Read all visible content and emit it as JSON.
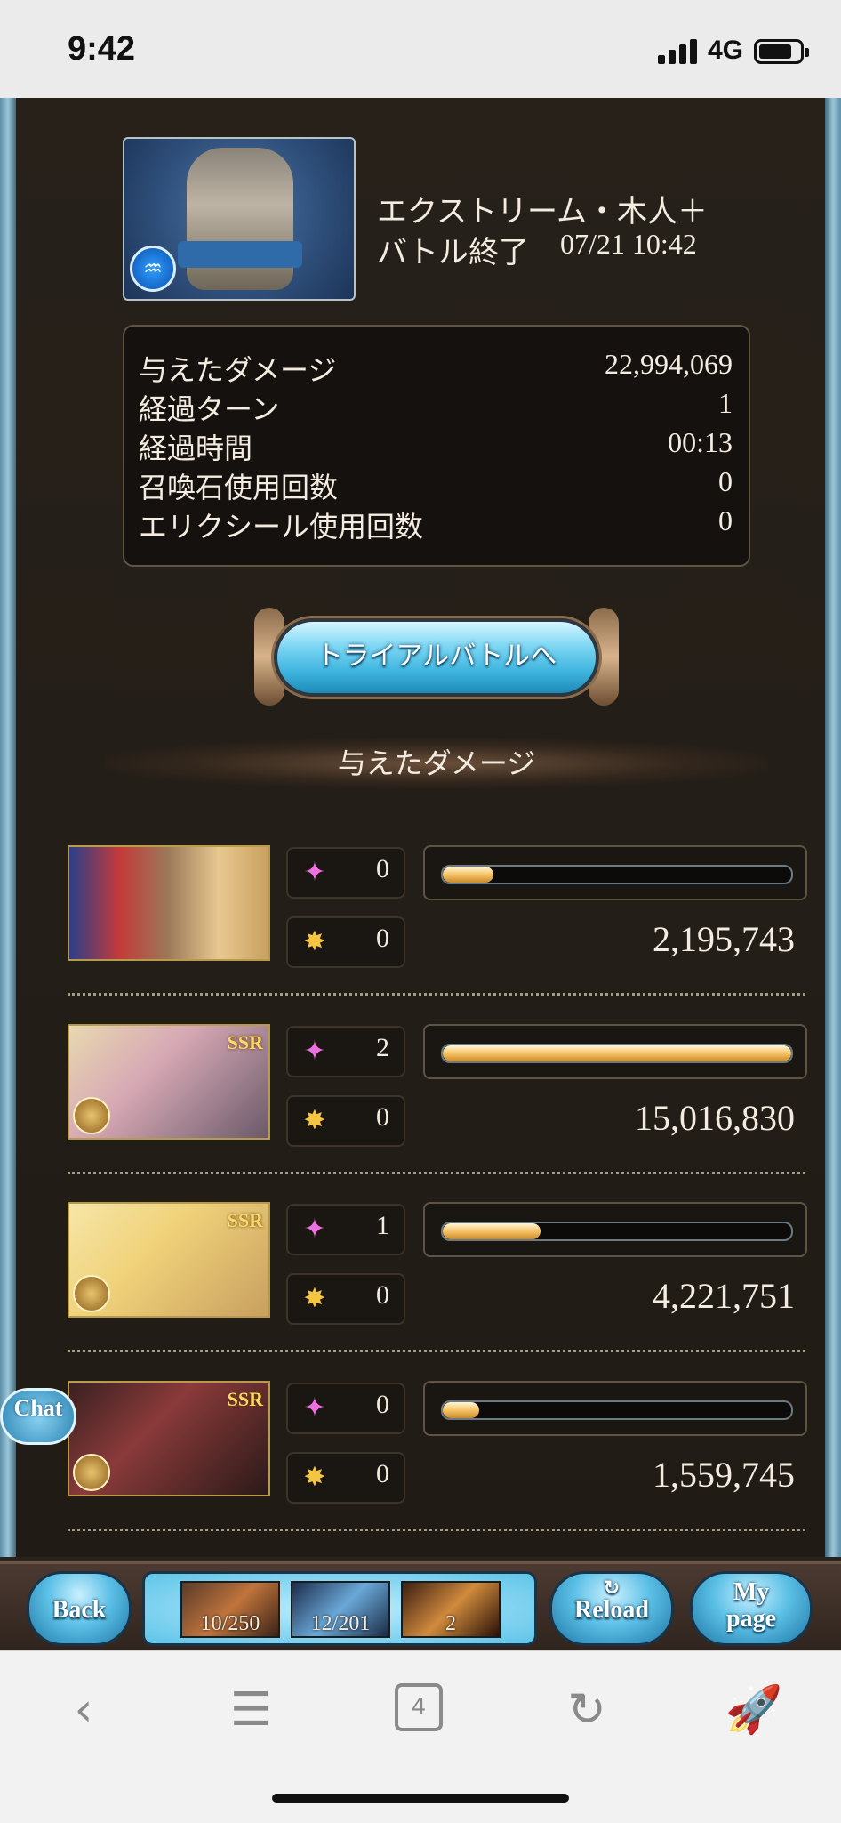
{
  "status_bar": {
    "time": "9:42",
    "network": "4G"
  },
  "battle": {
    "boss_name": "エクストリーム・木人＋",
    "status": "バトル終了",
    "datetime": "07/21 10:42",
    "element_icon": "water-icon"
  },
  "stats": [
    {
      "label": "与えたダメージ",
      "value": "22,994,069"
    },
    {
      "label": "経過ターン",
      "value": "1"
    },
    {
      "label": "経過時間",
      "value": "00:13"
    },
    {
      "label": "召喚石使用回数",
      "value": "0"
    },
    {
      "label": "エリクシール使用回数",
      "value": "0"
    }
  ],
  "trial_button": {
    "label": "トライアルバトルへ"
  },
  "section": {
    "title": "与えたダメージ"
  },
  "characters": [
    {
      "ssr": "",
      "ougi": "0",
      "chain": "0",
      "damage": "2,195,743",
      "ratio": 0.146
    },
    {
      "ssr": "SSR",
      "ougi": "2",
      "chain": "0",
      "damage": "15,016,830",
      "ratio": 1.0
    },
    {
      "ssr": "SSR",
      "ougi": "1",
      "chain": "0",
      "damage": "4,221,751",
      "ratio": 0.281
    },
    {
      "ssr": "SSR",
      "ougi": "0",
      "chain": "0",
      "damage": "1,559,745",
      "ratio": 0.104
    }
  ],
  "chat": {
    "label": "Chat"
  },
  "nav": {
    "back": "Back",
    "reload": "Reload",
    "mypage_line1": "My",
    "mypage_line2": "page",
    "items": [
      "10/250",
      "12/201",
      "2"
    ]
  },
  "safari": {
    "tabs": "4"
  },
  "colors": {
    "accent": "#5cc0e6",
    "bar": "#f5c366",
    "text": "#f4ece0"
  }
}
